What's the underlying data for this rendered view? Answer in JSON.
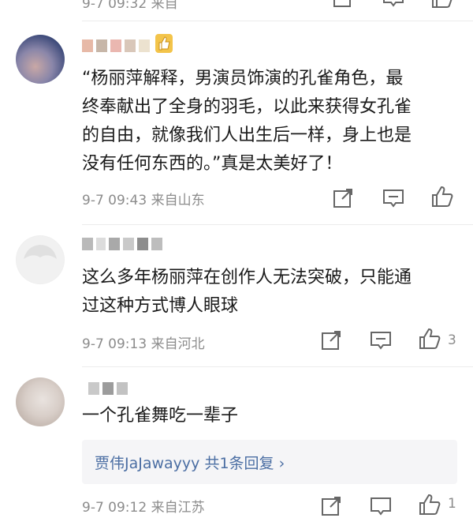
{
  "comments": [
    {
      "id": "top-partial",
      "meta": "9-7 09:32 来自",
      "like_count": ""
    },
    {
      "id": "c1",
      "badge_icon": "thumbs-up-badge-icon",
      "lines": [
        "“杨丽萍解释，男演员饰演的孔雀角色，最",
        "终奉献出了全身的羽毛，以此来获得女孔雀",
        "的自由，就像我们人出生后一样，身上也是",
        "没有任何东西的。”真是太美好了！"
      ],
      "meta": "9-7 09:43  来自山东",
      "like_count": ""
    },
    {
      "id": "c2",
      "lines": [
        "这么多年杨丽萍在创作人无法突破，只能通",
        "过这种方式博人眼球"
      ],
      "meta": "9-7 09:13  来自河北",
      "like_count": "3"
    },
    {
      "id": "c3",
      "lines": [
        "一个孔雀舞吃一辈子"
      ],
      "reply_summary": "贾伟JaJawayyy  共1条回复 ›",
      "meta": "9-7 09:12  来自江苏",
      "like_count": "1"
    }
  ],
  "icons": [
    "share-icon",
    "comment-icon",
    "like-icon",
    "chevron-right-icon"
  ],
  "colors": {
    "link": "#4b6ea3",
    "meta": "#8c8c8c",
    "text": "#1a1a1a"
  }
}
